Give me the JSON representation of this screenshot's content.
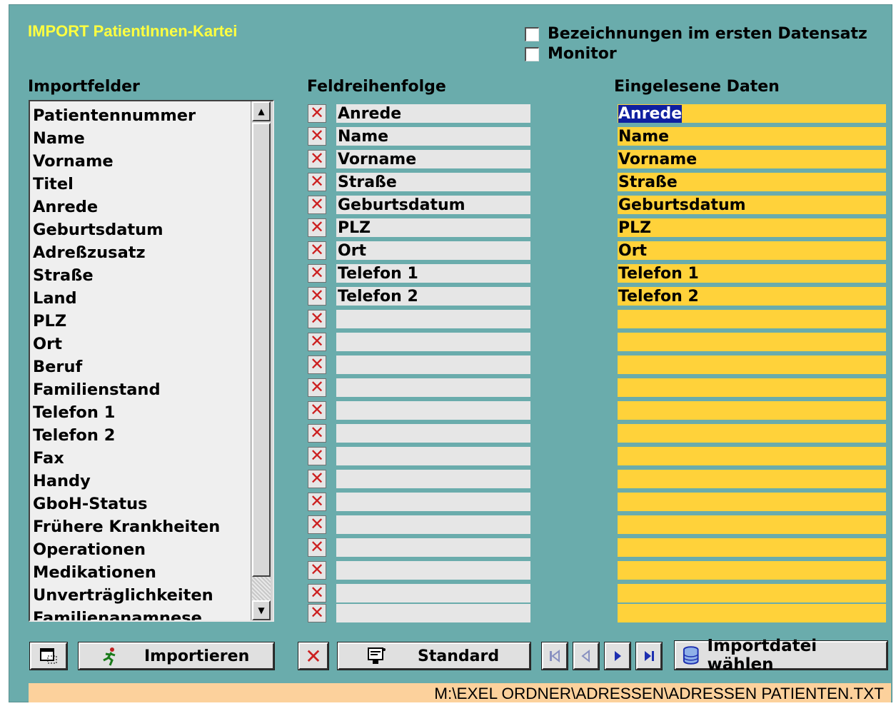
{
  "window": {
    "title": "IMPORT PatientInnen-Kartei"
  },
  "options": [
    {
      "label": "Bezeichnungen im ersten Datensatz",
      "checked": false
    },
    {
      "label": "Monitor",
      "checked": false
    }
  ],
  "headers": {
    "import_fields": "Importfelder",
    "field_order": "Feldreihenfolge",
    "read_data": "Eingelesene Daten"
  },
  "import_fields": [
    "Patientennummer",
    "Name",
    "Vorname",
    "Titel",
    "Anrede",
    "Geburtsdatum",
    "Adreßzusatz",
    "Straße",
    "Land",
    "PLZ",
    "Ort",
    "Beruf",
    "Familienstand",
    "Telefon 1",
    "Telefon 2",
    "Fax",
    "Handy",
    "GboH-Status",
    "Frühere Krankheiten",
    "Operationen",
    "Medikationen",
    "Unverträglichkeiten",
    "Familienanamnese"
  ],
  "field_order": [
    "Anrede",
    "Name",
    "Vorname",
    "Straße",
    "Geburtsdatum",
    "PLZ",
    "Ort",
    "Telefon 1",
    "Telefon 2",
    "",
    "",
    "",
    "",
    "",
    "",
    "",
    "",
    "",
    "",
    "",
    "",
    "",
    ""
  ],
  "read_data": [
    "Anrede",
    "Name",
    "Vorname",
    "Straße",
    "Geburtsdatum",
    "PLZ",
    "Ort",
    "Telefon 1",
    "Telefon 2",
    "",
    "",
    "",
    "",
    "",
    "",
    "",
    "",
    "",
    "",
    "",
    "",
    "",
    ""
  ],
  "buttons": {
    "import": "Importieren",
    "standard": "Standard",
    "choose_file": "Importdatei wählen"
  },
  "icons": {
    "remove": "✕"
  },
  "status": {
    "path": "M:\\EXEL ORDNER\\ADRESSEN\\ADRESSEN PATIENTEN.TXT"
  },
  "colors": {
    "window_bg": "#6aacac",
    "title": "#ffff40",
    "data_field": "#ffd23a",
    "status_bar": "#fcd19c"
  }
}
